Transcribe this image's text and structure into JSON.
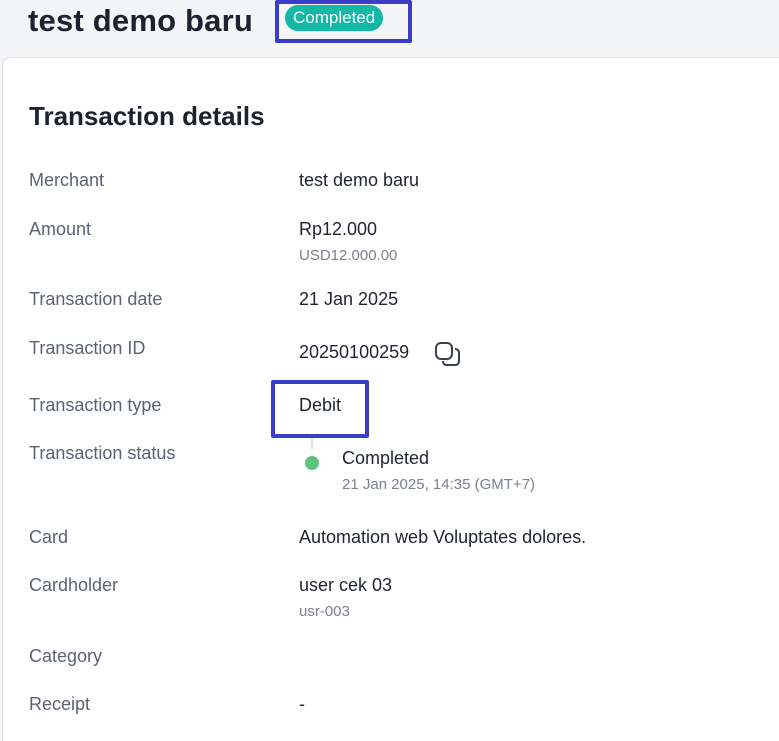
{
  "header": {
    "title": "test demo baru",
    "status_badge": "Completed"
  },
  "details": {
    "section_title": "Transaction details",
    "merchant": {
      "label": "Merchant",
      "value": "test demo baru"
    },
    "amount": {
      "label": "Amount",
      "value": "Rp12.000",
      "secondary": "USD12.000.00"
    },
    "transaction_date": {
      "label": "Transaction date",
      "value": "21 Jan 2025"
    },
    "transaction_id": {
      "label": "Transaction ID",
      "value": "20250100259",
      "copy_icon": "copy-icon"
    },
    "transaction_type": {
      "label": "Transaction type",
      "value": "Debit"
    },
    "transaction_status": {
      "label": "Transaction status",
      "value": "Completed",
      "timestamp": "21 Jan 2025, 14:35 (GMT+7)"
    },
    "card": {
      "label": "Card",
      "value": "Automation web Voluptates dolores."
    },
    "cardholder": {
      "label": "Cardholder",
      "value": "user cek 03",
      "secondary": "usr-003"
    },
    "category": {
      "label": "Category",
      "value": ""
    },
    "receipt": {
      "label": "Receipt",
      "value": "-"
    }
  },
  "colors": {
    "badge": "#14b8a6",
    "highlight": "#3b3ec7",
    "status_dot": "#5cc47d"
  }
}
